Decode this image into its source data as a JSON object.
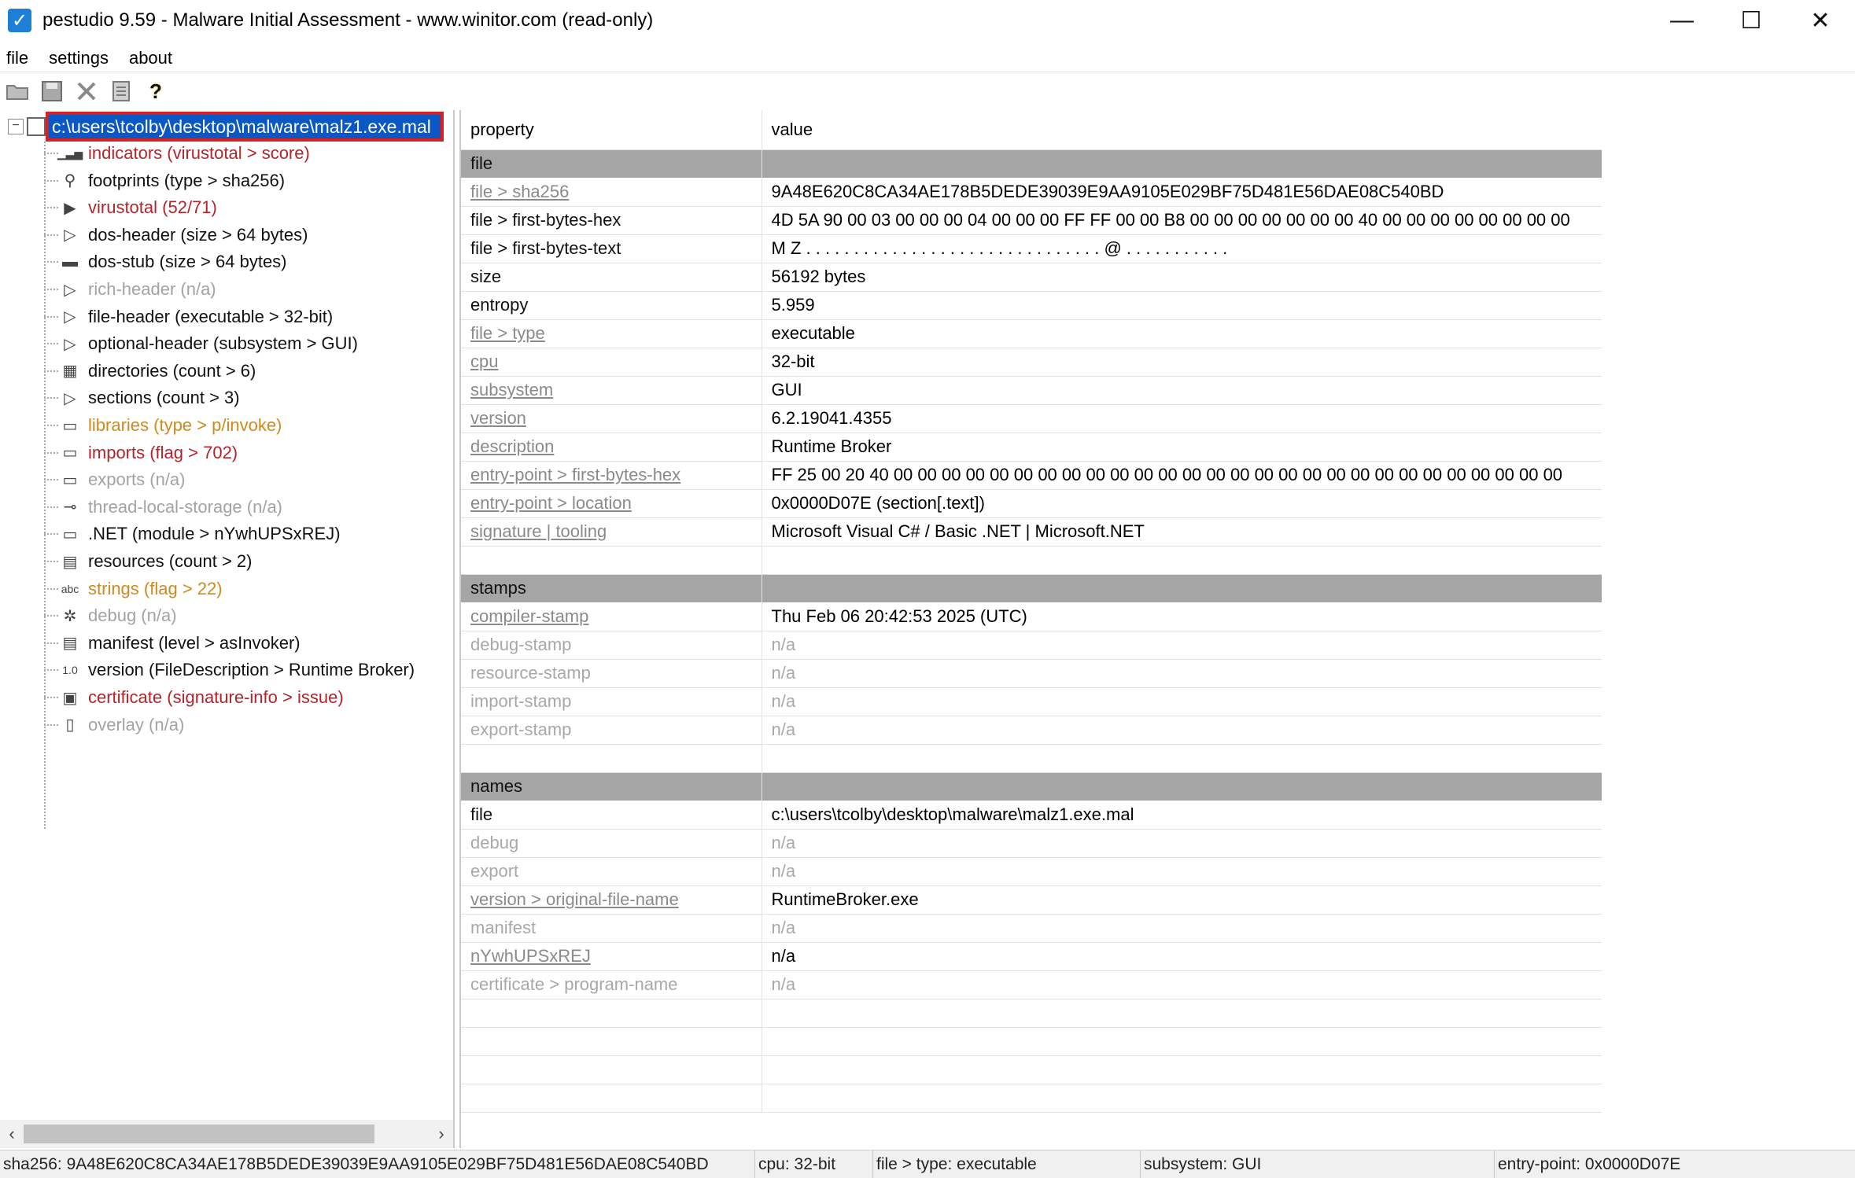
{
  "window": {
    "title": "pestudio 9.59 - Malware Initial Assessment - www.winitor.com (read-only)",
    "min_glyph": "—",
    "max_glyph": "☐",
    "close_glyph": "✕"
  },
  "menu": {
    "file": "file",
    "settings": "settings",
    "about": "about"
  },
  "toolbar": {
    "help_glyph": "?"
  },
  "tree": {
    "root_label": "c:\\users\\tcolby\\desktop\\malware\\malz1.exe.mal",
    "items": [
      {
        "label": "indicators (virustotal > score)",
        "color": "red",
        "icon": "chart-icon"
      },
      {
        "label": "footprints (type > sha256)",
        "color": "black",
        "icon": "footprints-icon"
      },
      {
        "label": "virustotal (52/71)",
        "color": "red",
        "icon": "virustotal-icon"
      },
      {
        "label": "dos-header (size > 64 bytes)",
        "color": "black",
        "icon": "expand-icon"
      },
      {
        "label": "dos-stub (size > 64 bytes)",
        "color": "black",
        "icon": "console-icon"
      },
      {
        "label": "rich-header (n/a)",
        "color": "gray",
        "icon": "expand-icon"
      },
      {
        "label": "file-header (executable > 32-bit)",
        "color": "black",
        "icon": "expand-icon"
      },
      {
        "label": "optional-header (subsystem > GUI)",
        "color": "black",
        "icon": "expand-icon"
      },
      {
        "label": "directories (count > 6)",
        "color": "black",
        "icon": "grid-icon"
      },
      {
        "label": "sections (count > 3)",
        "color": "black",
        "icon": "expand-icon"
      },
      {
        "label": "libraries (type > p/invoke)",
        "color": "orange",
        "icon": "library-icon"
      },
      {
        "label": "imports (flag > 702)",
        "color": "red",
        "icon": "imports-icon"
      },
      {
        "label": "exports (n/a)",
        "color": "gray",
        "icon": "exports-icon"
      },
      {
        "label": "thread-local-storage (n/a)",
        "color": "gray",
        "icon": "tls-icon"
      },
      {
        "label": ".NET (module > nYwhUPSxREJ)",
        "color": "black",
        "icon": "dotnet-icon"
      },
      {
        "label": "resources (count > 2)",
        "color": "black",
        "icon": "resources-icon"
      },
      {
        "label": "strings (flag > 22)",
        "color": "orange",
        "icon": "strings-icon"
      },
      {
        "label": "debug (n/a)",
        "color": "gray",
        "icon": "bug-icon"
      },
      {
        "label": "manifest (level > asInvoker)",
        "color": "black",
        "icon": "manifest-icon"
      },
      {
        "label": "version (FileDescription > Runtime Broker)",
        "color": "black",
        "icon": "version-icon"
      },
      {
        "label": "certificate (signature-info > issue)",
        "color": "red",
        "icon": "certificate-icon"
      },
      {
        "label": "overlay (n/a)",
        "color": "gray",
        "icon": "overlay-icon"
      }
    ],
    "icon_glyphs": {
      "chart-icon": "▁▃▅",
      "footprints-icon": "⚲",
      "virustotal-icon": "▶",
      "expand-icon": "▷",
      "console-icon": "▬",
      "grid-icon": "▦",
      "library-icon": "▭",
      "imports-icon": "▭",
      "exports-icon": "▭",
      "tls-icon": "⊸",
      "dotnet-icon": "▭",
      "resources-icon": "▤",
      "strings-icon": "abc",
      "bug-icon": "✲",
      "manifest-icon": "▤",
      "version-icon": "1.0",
      "certificate-icon": "▣",
      "overlay-icon": "▯"
    }
  },
  "table": {
    "header": {
      "property": "property",
      "value": "value"
    },
    "rows": [
      {
        "type": "section",
        "property": "file",
        "value": ""
      },
      {
        "type": "row",
        "property": "file > sha256",
        "pstyle": "link",
        "value": "9A48E620C8CA34AE178B5DEDE39039E9AA9105E029BF75D481E56DAE08C540BD",
        "vstyle": "black"
      },
      {
        "type": "row",
        "property": "file > first-bytes-hex",
        "pstyle": "black",
        "value": "4D 5A 90 00 03 00 00 00 04 00 00 00 FF FF 00 00 B8 00 00 00 00 00 00 00 40 00 00 00 00 00 00 00 00",
        "vstyle": "black"
      },
      {
        "type": "row",
        "property": "file > first-bytes-text",
        "pstyle": "black",
        "value": "M Z . . . . . . . . . . . . . . . . . . . . . . . . . . . . . . . @ . . . . . . . . . . .",
        "vstyle": "black"
      },
      {
        "type": "row",
        "property": "size",
        "pstyle": "black",
        "value": "56192 bytes",
        "vstyle": "black"
      },
      {
        "type": "row",
        "property": "entropy",
        "pstyle": "black",
        "value": "5.959",
        "vstyle": "black"
      },
      {
        "type": "row",
        "property": "file > type",
        "pstyle": "link",
        "value": "executable",
        "vstyle": "black"
      },
      {
        "type": "row",
        "property": "cpu",
        "pstyle": "link",
        "value": "32-bit",
        "vstyle": "black"
      },
      {
        "type": "row",
        "property": "subsystem",
        "pstyle": "link",
        "value": "GUI",
        "vstyle": "black"
      },
      {
        "type": "row",
        "property": "version",
        "pstyle": "link",
        "value": "6.2.19041.4355",
        "vstyle": "black"
      },
      {
        "type": "row",
        "property": "description",
        "pstyle": "link",
        "value": "Runtime Broker",
        "vstyle": "black"
      },
      {
        "type": "row",
        "property": "entry-point > first-bytes-hex",
        "pstyle": "link",
        "value": "FF 25 00 20 40 00 00 00 00 00 00 00 00 00 00 00 00 00 00 00 00 00 00 00 00 00 00 00 00 00 00 00 00",
        "vstyle": "black"
      },
      {
        "type": "row",
        "property": "entry-point > location",
        "pstyle": "link",
        "value": "0x0000D07E (section[.text])",
        "vstyle": "black"
      },
      {
        "type": "row",
        "property": "signature | tooling",
        "pstyle": "link",
        "value": "Microsoft Visual C# / Basic .NET | Microsoft.NET",
        "vstyle": "black"
      },
      {
        "type": "blank",
        "property": "",
        "value": ""
      },
      {
        "type": "section",
        "property": "stamps",
        "value": ""
      },
      {
        "type": "row",
        "property": "compiler-stamp",
        "pstyle": "link",
        "value": "Thu Feb 06 20:42:53 2025 (UTC)",
        "vstyle": "black"
      },
      {
        "type": "row",
        "property": "debug-stamp",
        "pstyle": "gray",
        "value": "n/a",
        "vstyle": "gray"
      },
      {
        "type": "row",
        "property": "resource-stamp",
        "pstyle": "gray",
        "value": "n/a",
        "vstyle": "gray"
      },
      {
        "type": "row",
        "property": "import-stamp",
        "pstyle": "gray",
        "value": "n/a",
        "vstyle": "gray"
      },
      {
        "type": "row",
        "property": "export-stamp",
        "pstyle": "gray",
        "value": "n/a",
        "vstyle": "gray"
      },
      {
        "type": "blank",
        "property": "",
        "value": ""
      },
      {
        "type": "section",
        "property": "names",
        "value": ""
      },
      {
        "type": "row",
        "property": "file",
        "pstyle": "black",
        "value": "c:\\users\\tcolby\\desktop\\malware\\malz1.exe.mal",
        "vstyle": "black"
      },
      {
        "type": "row",
        "property": "debug",
        "pstyle": "gray",
        "value": "n/a",
        "vstyle": "gray"
      },
      {
        "type": "row",
        "property": "export",
        "pstyle": "gray",
        "value": "n/a",
        "vstyle": "gray"
      },
      {
        "type": "row",
        "property": "version > original-file-name",
        "pstyle": "link",
        "value": "RuntimeBroker.exe",
        "vstyle": "black"
      },
      {
        "type": "row",
        "property": "manifest",
        "pstyle": "gray",
        "value": "n/a",
        "vstyle": "gray"
      },
      {
        "type": "row",
        "property": "nYwhUPSxREJ",
        "pstyle": "link",
        "value": "n/a",
        "vstyle": "black"
      },
      {
        "type": "row",
        "property": "certificate > program-name",
        "pstyle": "gray",
        "value": "n/a",
        "vstyle": "gray"
      },
      {
        "type": "blank",
        "property": "",
        "value": ""
      },
      {
        "type": "blank",
        "property": "",
        "value": ""
      },
      {
        "type": "blank",
        "property": "",
        "value": ""
      },
      {
        "type": "blank",
        "property": "",
        "value": ""
      }
    ]
  },
  "statusbar": {
    "sha256": "sha256: 9A48E620C8CA34AE178B5DEDE39039E9AA9105E029BF75D481E56DAE08C540BD",
    "cpu": "cpu: 32-bit",
    "type": "file > type: executable",
    "subsystem": "subsystem: GUI",
    "entry": "entry-point: 0x0000D07E"
  }
}
